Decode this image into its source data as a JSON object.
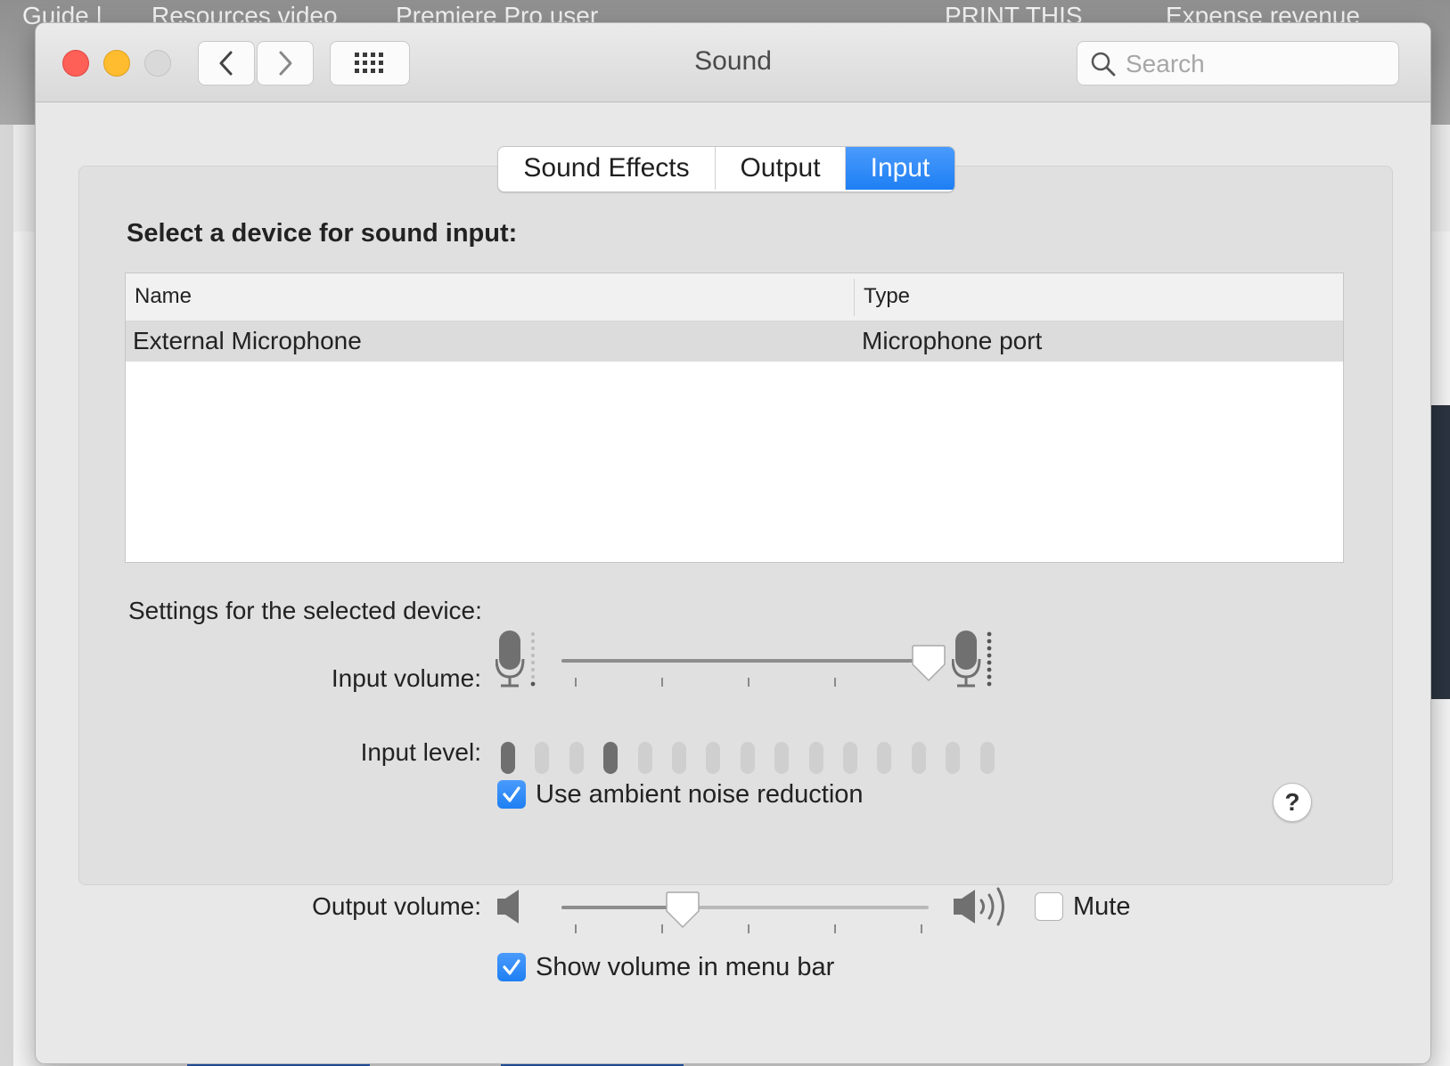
{
  "background": {
    "tabs": [
      "Guide |",
      "Resources video",
      "Premiere Pro user",
      "PRINT THIS",
      "Expense revenue"
    ]
  },
  "window": {
    "title": "Sound",
    "search": {
      "placeholder": "Search",
      "value": ""
    }
  },
  "tabs": [
    {
      "label": "Sound Effects",
      "active": false
    },
    {
      "label": "Output",
      "active": false
    },
    {
      "label": "Input",
      "active": true
    }
  ],
  "input_panel": {
    "heading": "Select a device for sound input:",
    "table": {
      "columns": [
        "Name",
        "Type"
      ],
      "rows": [
        {
          "name": "External Microphone",
          "type": "Microphone port",
          "selected": true
        }
      ]
    },
    "settings_heading": "Settings for the selected device:",
    "input_volume": {
      "label": "Input volume:",
      "value": 1.0
    },
    "input_level": {
      "label": "Input level:",
      "segments": 15,
      "lit": [
        1,
        4
      ]
    },
    "ambient_noise": {
      "label": "Use ambient noise reduction",
      "checked": true
    }
  },
  "output_volume": {
    "label": "Output volume:",
    "value": 0.33
  },
  "mute": {
    "label": "Mute",
    "checked": false
  },
  "show_volume": {
    "label": "Show volume in menu bar",
    "checked": true
  },
  "colors": {
    "accent": "#1e7ff3",
    "close": "#fe5f57",
    "minimize": "#febc2e"
  }
}
